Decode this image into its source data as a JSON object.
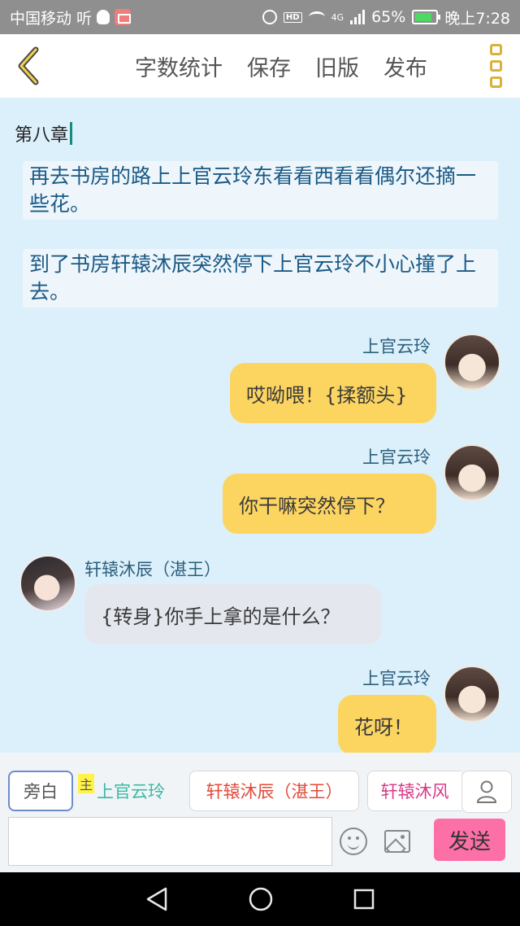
{
  "status_bar": {
    "carrier": "中国移动",
    "carrier_extra": "听",
    "network": "4G",
    "battery_percent": "65%",
    "time": "晚上7:28",
    "icons": [
      "qq-icon",
      "mail-icon",
      "alarm-icon",
      "hd-icon",
      "wifi-icon",
      "signal-icon",
      "battery-icon"
    ]
  },
  "header": {
    "back_icon": "chevron-left-icon",
    "actions": [
      {
        "label": "字数统计"
      },
      {
        "label": "保存"
      },
      {
        "label": "旧版"
      },
      {
        "label": "发布"
      }
    ],
    "more_icon": "more-vertical-icon",
    "accent_color": "#d7b33a"
  },
  "chapter": {
    "title": "第八章"
  },
  "messages": [
    {
      "type": "narration",
      "text": "再去书房的路上上官云玲东看看西看看偶尔还摘一些花。"
    },
    {
      "type": "narration",
      "text": "到了书房轩辕沐辰突然停下上官云玲不小心撞了上去。"
    },
    {
      "type": "dialog",
      "side": "right",
      "speaker": "上官云玲",
      "text": "哎呦喂！{揉额头}"
    },
    {
      "type": "dialog",
      "side": "right",
      "speaker": "上官云玲",
      "text": "你干嘛突然停下？"
    },
    {
      "type": "dialog",
      "side": "left",
      "speaker": "轩辕沐辰（湛王）",
      "text": "{转身}你手上拿的是什么？"
    },
    {
      "type": "dialog",
      "side": "right",
      "speaker": "上官云玲",
      "text": "花呀！"
    }
  ],
  "roles": {
    "narrator": "旁白",
    "main_tag": "主",
    "list": [
      {
        "name": "上官云玲",
        "color": "#3bb9a5"
      },
      {
        "name": "轩辕沐辰（湛王）",
        "color": "#e24a3a"
      },
      {
        "name": "轩辕沐风",
        "color": "#d93a8a"
      }
    ],
    "profile_icon": "user-icon"
  },
  "composer": {
    "input_value": "",
    "emoji_icon": "emoji-icon",
    "image_icon": "image-icon",
    "send_label": "发送",
    "send_color": "#fd6fa7"
  },
  "nav": {
    "icons": [
      "back-triangle-icon",
      "home-circle-icon",
      "recents-square-icon"
    ]
  }
}
